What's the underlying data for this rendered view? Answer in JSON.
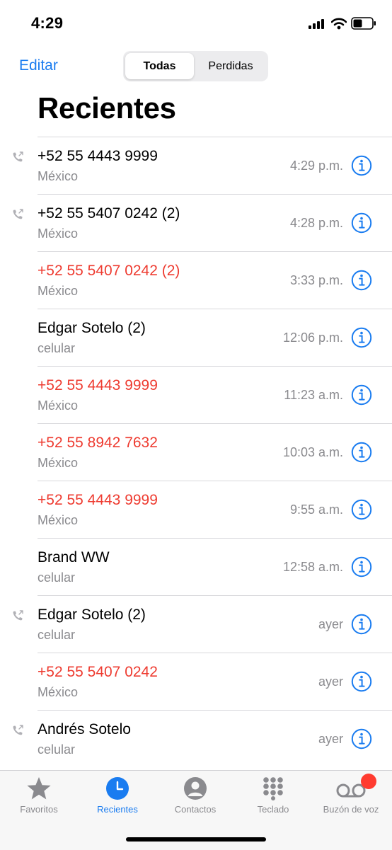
{
  "status_bar": {
    "time": "4:29"
  },
  "nav": {
    "edit_label": "Editar",
    "segments": [
      "Todas",
      "Perdidas"
    ],
    "selected_segment": "Todas",
    "title": "Recientes"
  },
  "colors": {
    "accent": "#1a7cf0",
    "missed": "#ee3b30",
    "secondary": "#8a8a8e"
  },
  "calls": [
    {
      "name": "+52 55 4443 9999",
      "subtitle": "México",
      "time": "4:29 p.m.",
      "missed": false,
      "outgoing": true
    },
    {
      "name": "+52 55 5407 0242 (2)",
      "subtitle": "México",
      "time": "4:28 p.m.",
      "missed": false,
      "outgoing": true
    },
    {
      "name": "+52 55 5407 0242 (2)",
      "subtitle": "México",
      "time": "3:33 p.m.",
      "missed": true,
      "outgoing": false
    },
    {
      "name": "Edgar Sotelo (2)",
      "subtitle": "celular",
      "time": "12:06 p.m.",
      "missed": false,
      "outgoing": false
    },
    {
      "name": "+52 55 4443 9999",
      "subtitle": "México",
      "time": "11:23 a.m.",
      "missed": true,
      "outgoing": false
    },
    {
      "name": "+52 55 8942 7632",
      "subtitle": "México",
      "time": "10:03 a.m.",
      "missed": true,
      "outgoing": false
    },
    {
      "name": "+52 55 4443 9999",
      "subtitle": "México",
      "time": "9:55 a.m.",
      "missed": true,
      "outgoing": false
    },
    {
      "name": "Brand WW",
      "subtitle": "celular",
      "time": "12:58 a.m.",
      "missed": false,
      "outgoing": false
    },
    {
      "name": "Edgar Sotelo (2)",
      "subtitle": "celular",
      "time": "ayer",
      "missed": false,
      "outgoing": true
    },
    {
      "name": "+52 55 5407 0242",
      "subtitle": "México",
      "time": "ayer",
      "missed": true,
      "outgoing": false
    },
    {
      "name": "Andrés Sotelo",
      "subtitle": "celular",
      "time": "ayer",
      "missed": false,
      "outgoing": true
    }
  ],
  "tabs": [
    {
      "label": "Favoritos",
      "icon": "star-icon",
      "active": false
    },
    {
      "label": "Recientes",
      "icon": "clock-icon",
      "active": true
    },
    {
      "label": "Contactos",
      "icon": "person-icon",
      "active": false
    },
    {
      "label": "Teclado",
      "icon": "keypad-icon",
      "active": false
    },
    {
      "label": "Buzón de voz",
      "icon": "voicemail-icon",
      "active": false,
      "badge": true
    }
  ]
}
